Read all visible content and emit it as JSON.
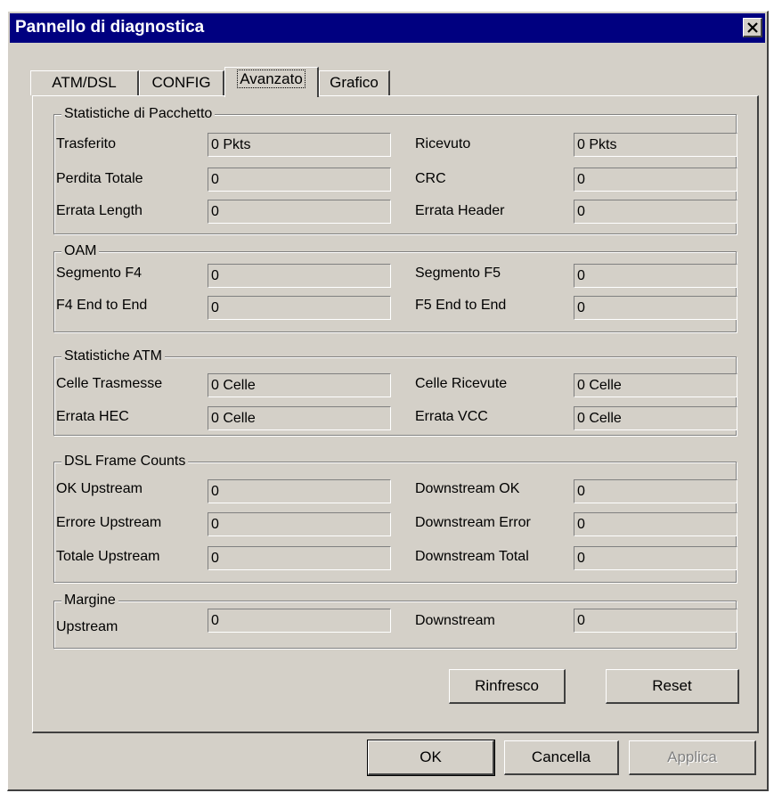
{
  "window": {
    "title": "Pannello di diagnostica"
  },
  "tabs": [
    {
      "label": "ATM/DSL",
      "active": false
    },
    {
      "label": "CONFIG",
      "active": false
    },
    {
      "label": "Avanzato",
      "active": true
    },
    {
      "label": "Grafico",
      "active": false
    }
  ],
  "packet": {
    "title": "Statistiche di Pacchetto",
    "rows": [
      {
        "left_label": "Trasferito",
        "left_value": "0 Pkts",
        "right_label": "Ricevuto",
        "right_value": "0 Pkts"
      },
      {
        "left_label": "Perdita Totale",
        "left_value": "0",
        "right_label": "CRC",
        "right_value": "0"
      },
      {
        "left_label": "Errata Length",
        "left_value": "0",
        "right_label": "Errata Header",
        "right_value": "0"
      }
    ]
  },
  "oam": {
    "title": "OAM",
    "rows": [
      {
        "left_label": "Segmento F4",
        "left_value": "0",
        "right_label": "Segmento F5",
        "right_value": "0"
      },
      {
        "left_label": "F4 End to End",
        "left_value": "0",
        "right_label": "F5 End to End",
        "right_value": "0"
      }
    ]
  },
  "atm": {
    "title": "Statistiche ATM",
    "rows": [
      {
        "left_label": "Celle Trasmesse",
        "left_value": "0 Celle",
        "right_label": "Celle Ricevute",
        "right_value": "0 Celle"
      },
      {
        "left_label": "Errata HEC",
        "left_value": "0 Celle",
        "right_label": "Errata VCC",
        "right_value": "0 Celle"
      }
    ]
  },
  "dsl": {
    "title": "DSL Frame Counts",
    "rows": [
      {
        "left_label": "OK Upstream",
        "left_value": "0",
        "right_label": "Downstream OK",
        "right_value": "0"
      },
      {
        "left_label": "Errore Upstream",
        "left_value": "0",
        "right_label": "Downstream Error",
        "right_value": "0"
      },
      {
        "left_label": "Totale Upstream",
        "left_value": "0",
        "right_label": "Downstream Total",
        "right_value": "0"
      }
    ]
  },
  "margin": {
    "title": "Margine",
    "rows": [
      {
        "left_label": "Upstream",
        "left_value": "0",
        "right_label": "Downstream",
        "right_value": "0"
      }
    ]
  },
  "panel_buttons": {
    "refresh": "Rinfresco",
    "reset": "Reset"
  },
  "dialog_buttons": {
    "ok": "OK",
    "cancel": "Cancella",
    "apply": "Applica"
  }
}
